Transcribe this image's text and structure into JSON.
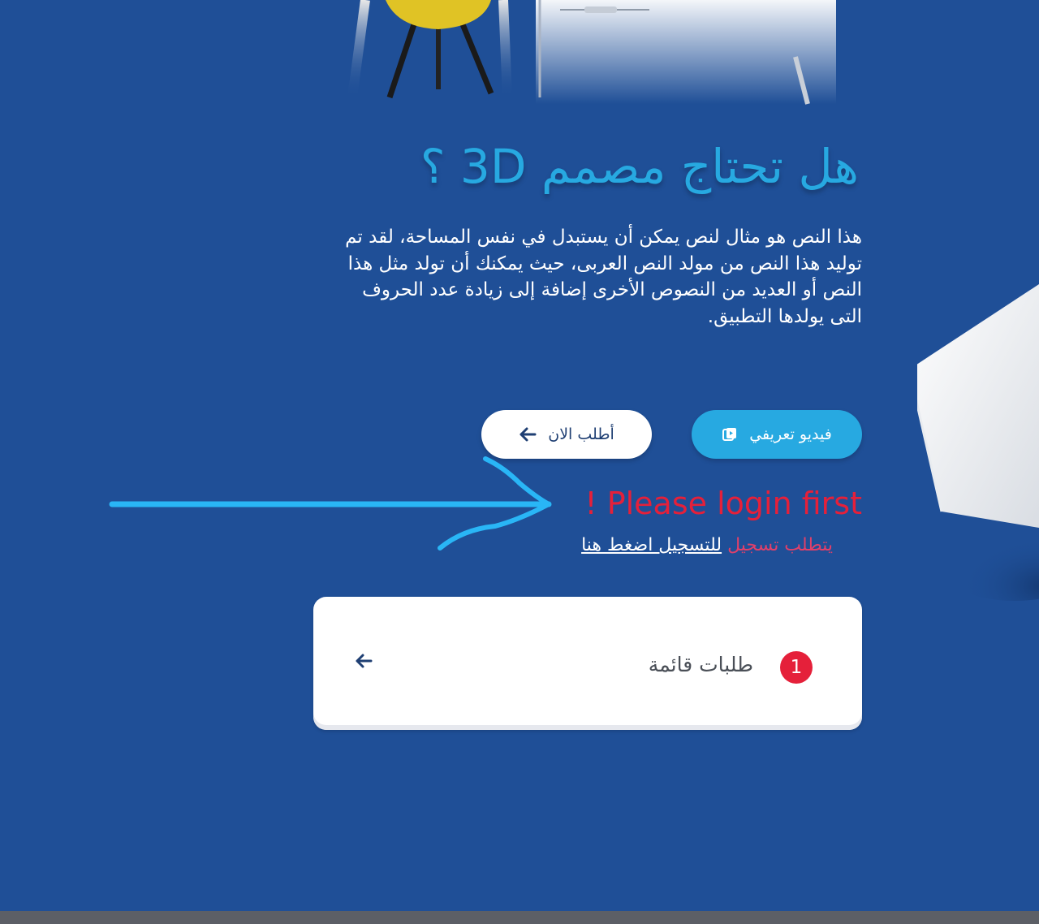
{
  "hero": {
    "title": "هل تحتاج مصمم 3D ؟",
    "description": "هذا النص هو مثال لنص يمكن أن يستبدل في نفس المساحة، لقد تم توليد هذا النص من مولد النص العربى، حيث يمكنك أن تولد مثل هذا النص أو العديد من النصوص الأخرى إضافة إلى زيادة عدد الحروف التى يولدها التطبيق."
  },
  "buttons": {
    "video_label": "فيديو تعريفي",
    "order_label": "أطلب الان"
  },
  "alert": {
    "login_message": "! Please login first",
    "register_required": "يتطلب تسجيل",
    "register_link": "للتسجيل اضغط هنا"
  },
  "card": {
    "badge_count": "1",
    "label": "طلبات قائمة"
  },
  "colors": {
    "background": "#1f4f97",
    "accent": "#27a9e1",
    "error": "#e5203a",
    "annotation": "#29b6f6"
  },
  "icons": {
    "video": "video-icon",
    "order_arrow": "arrow-left-icon",
    "card_arrow": "arrow-left-icon"
  }
}
